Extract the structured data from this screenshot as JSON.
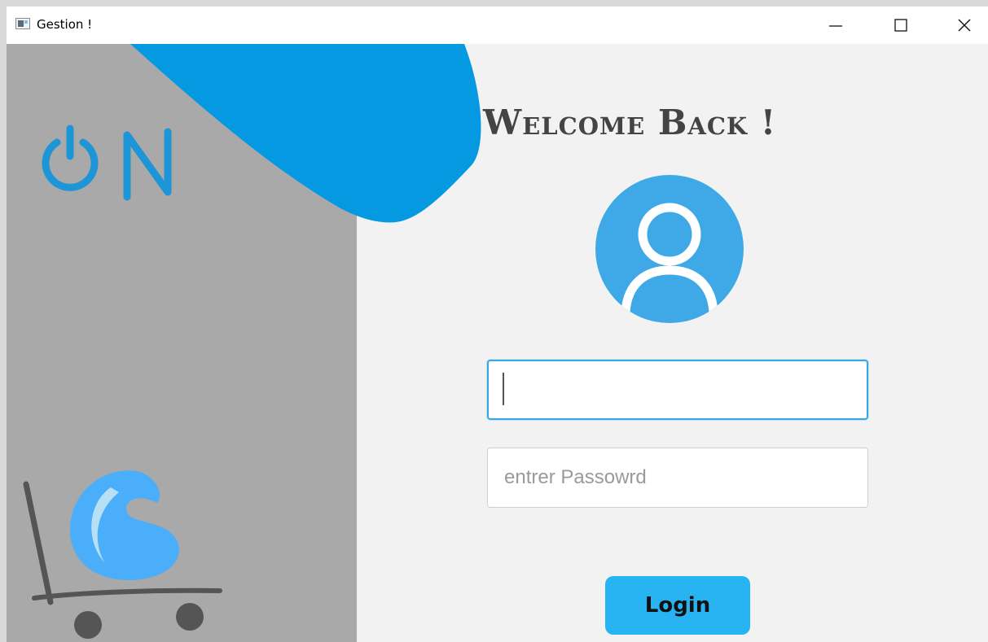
{
  "window": {
    "title": "Gestion !"
  },
  "titlebar": {
    "minimize_icon": "minimize-icon",
    "maximize_icon": "maximize-icon",
    "close_icon": "close-icon"
  },
  "branding": {
    "logo_text": "ON",
    "colors": {
      "accent": "#0599e2",
      "panel": "#a9a9a9",
      "button": "#28b4f2",
      "avatar": "#3ea9e6"
    }
  },
  "login": {
    "heading": "Welcome Back !",
    "avatar_icon": "user-icon",
    "username": {
      "value": "",
      "placeholder": ""
    },
    "password": {
      "value": "",
      "placeholder": "entrer Passowrd"
    },
    "button_label": "Login"
  }
}
